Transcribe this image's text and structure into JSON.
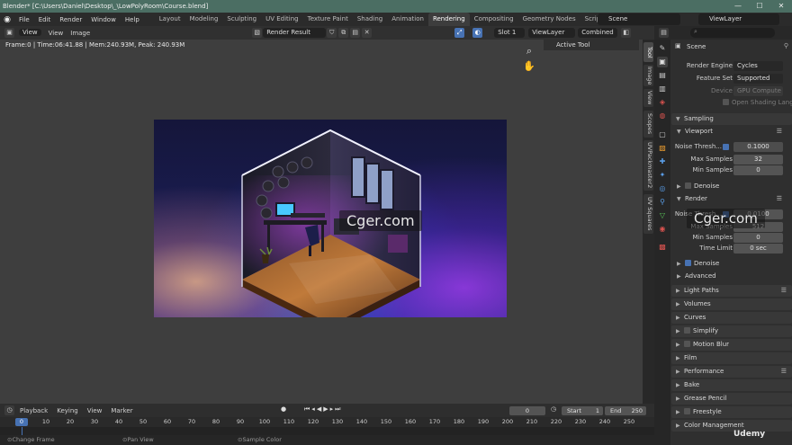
{
  "titlebar": {
    "title": "Blender* [C:\\Users\\Daniel\\Desktop\\_\\LowPolyRoom\\Course.blend]",
    "minimize": "—",
    "maximize": "☐",
    "close": "✕"
  },
  "menubar": {
    "items": [
      "File",
      "Edit",
      "Render",
      "Window",
      "Help"
    ],
    "workspaces": [
      "Layout",
      "Modeling",
      "Sculpting",
      "UV Editing",
      "Texture Paint",
      "Shading",
      "Animation",
      "Rendering",
      "Compositing",
      "Geometry Nodes",
      "Scripting"
    ],
    "add_tab": "+",
    "scene": "Scene",
    "view_layer": "ViewLayer"
  },
  "image_editor_header": {
    "view": "View",
    "view2": "View",
    "image": "Image",
    "image_name": "Render Result",
    "slot": "Slot 1",
    "layer": "ViewLayer",
    "pass": "Combined"
  },
  "viewport": {
    "stats": "Frame:0 | Time:06:41.88 | Mem:240.93M, Peak: 240.93M",
    "active_tool": "Active Tool"
  },
  "side_tabs": [
    "Tool",
    "Image",
    "View",
    "Scopes",
    "UVPackmaster2",
    "UV Squares"
  ],
  "watermark": "Cger.com",
  "timeline": {
    "playback": "Playback",
    "keying": "Keying",
    "view": "View",
    "marker": "Marker",
    "current_frame": "0",
    "start_label": "Start",
    "start": "1",
    "end_label": "End",
    "end": "250",
    "ruler": [
      "0",
      "10",
      "20",
      "30",
      "40",
      "50",
      "60",
      "70",
      "80",
      "90",
      "100",
      "110",
      "120",
      "130",
      "140",
      "150",
      "160",
      "170",
      "180",
      "190",
      "200",
      "210",
      "220",
      "230",
      "240",
      "250"
    ],
    "status": [
      "Change Frame",
      "Pan View",
      "Sample Color"
    ]
  },
  "properties": {
    "scene_label": "Scene",
    "render_engine_label": "Render Engine",
    "render_engine": "Cycles",
    "feature_set_label": "Feature Set",
    "feature_set": "Supported",
    "device_label": "Device",
    "device": "GPU Compute",
    "osl": "Open Shading Lang...",
    "sampling": "Sampling",
    "viewport": "Viewport",
    "noise_label": "Noise Thresh...",
    "noise_value": "0.1000",
    "max_samples_label": "Max Samples",
    "max_samples": "32",
    "min_samples_label": "Min Samples",
    "min_samples": "0",
    "denoise": "Denoise",
    "render": "Render",
    "r_noise_label": "Noise Thresh...",
    "r_noise_value": "0.0100",
    "r_max_label": "Max Samples",
    "r_max": "512",
    "r_min_label": "Min Samples",
    "r_min": "0",
    "time_limit_label": "Time Limit",
    "time_limit": "0 sec",
    "r_denoise": "Denoise",
    "advanced": "Advanced",
    "panels": [
      "Light Paths",
      "Volumes",
      "Curves",
      "Simplify",
      "Motion Blur",
      "Film",
      "Performance",
      "Bake",
      "Grease Pencil",
      "Freestyle",
      "Color Management"
    ]
  },
  "brand": "Udemy"
}
